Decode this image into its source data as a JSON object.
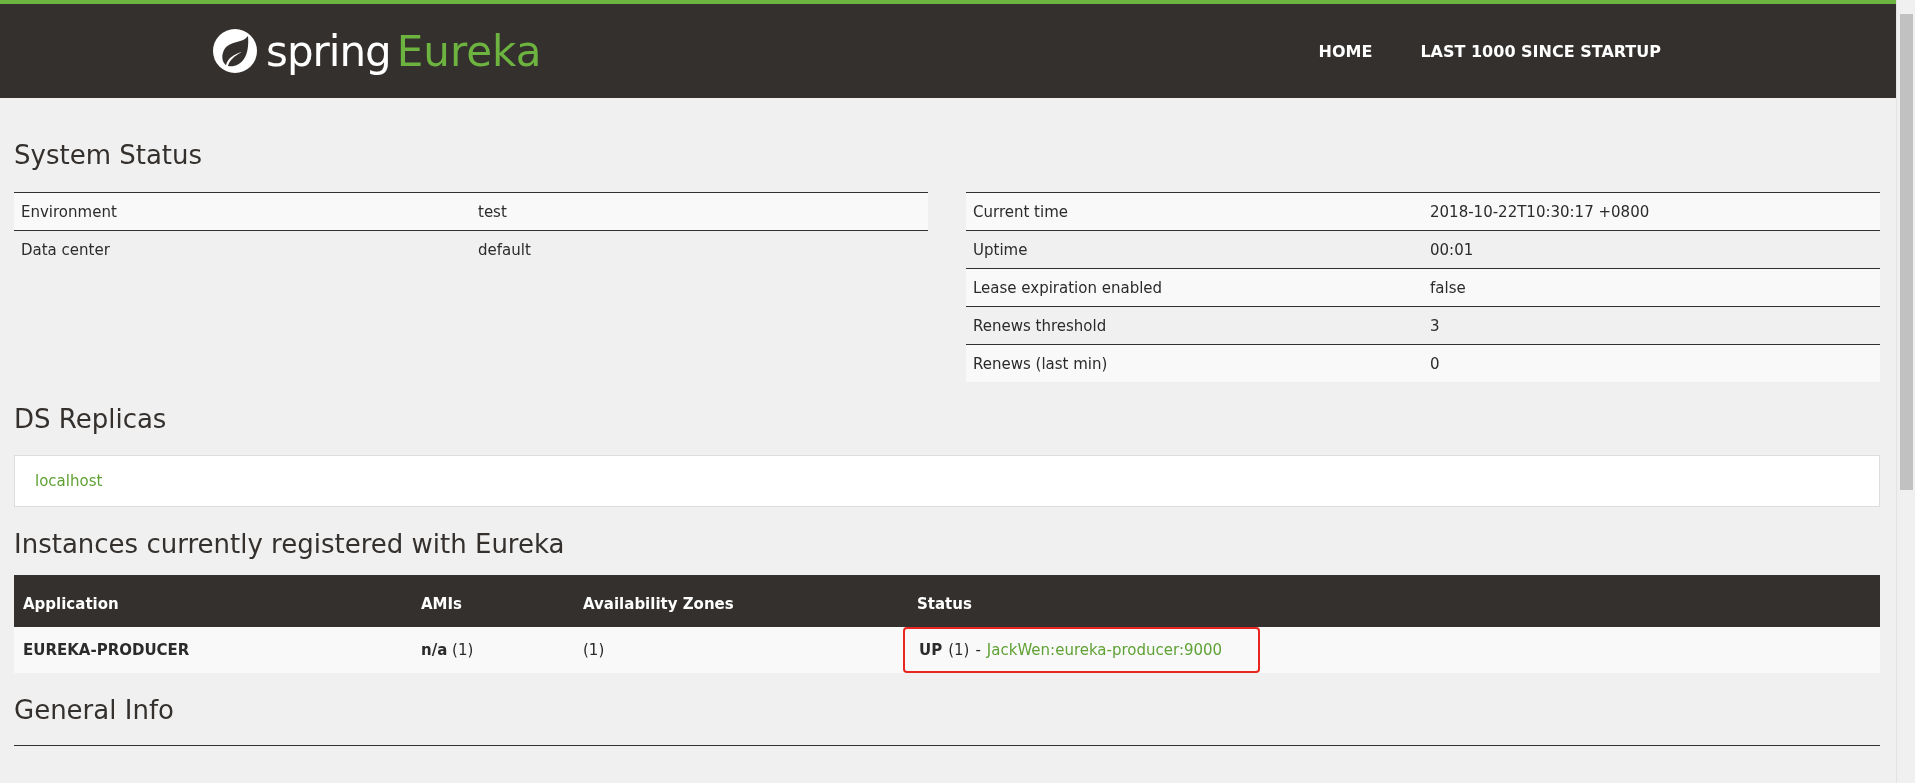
{
  "header": {
    "logo": {
      "word": "spring",
      "product": "Eureka"
    },
    "nav": [
      {
        "label": "HOME"
      },
      {
        "label": "LAST 1000 SINCE STARTUP"
      }
    ]
  },
  "system_status": {
    "title": "System Status",
    "left_table": [
      {
        "name": "Environment",
        "value": "test"
      },
      {
        "name": "Data center",
        "value": "default"
      }
    ],
    "right_table": [
      {
        "name": "Current time",
        "value": "2018-10-22T10:30:17 +0800"
      },
      {
        "name": "Uptime",
        "value": "00:01"
      },
      {
        "name": "Lease expiration enabled",
        "value": "false"
      },
      {
        "name": "Renews threshold",
        "value": "3"
      },
      {
        "name": "Renews (last min)",
        "value": "0"
      }
    ]
  },
  "ds_replicas": {
    "title": "DS Replicas",
    "items": [
      "localhost"
    ]
  },
  "instances": {
    "title": "Instances currently registered with Eureka",
    "columns": [
      "Application",
      "AMIs",
      "Availability Zones",
      "Status"
    ],
    "rows": [
      {
        "application": "EUREKA-PRODUCER",
        "amis": {
          "label": "n/a",
          "count": "(1)"
        },
        "zones": "(1)",
        "status": {
          "state": "UP",
          "count": "(1)",
          "separator": "-",
          "instance": "JackWen:eureka-producer:9000",
          "highlighted": true
        }
      }
    ]
  },
  "general_info": {
    "title": "General Info"
  }
}
